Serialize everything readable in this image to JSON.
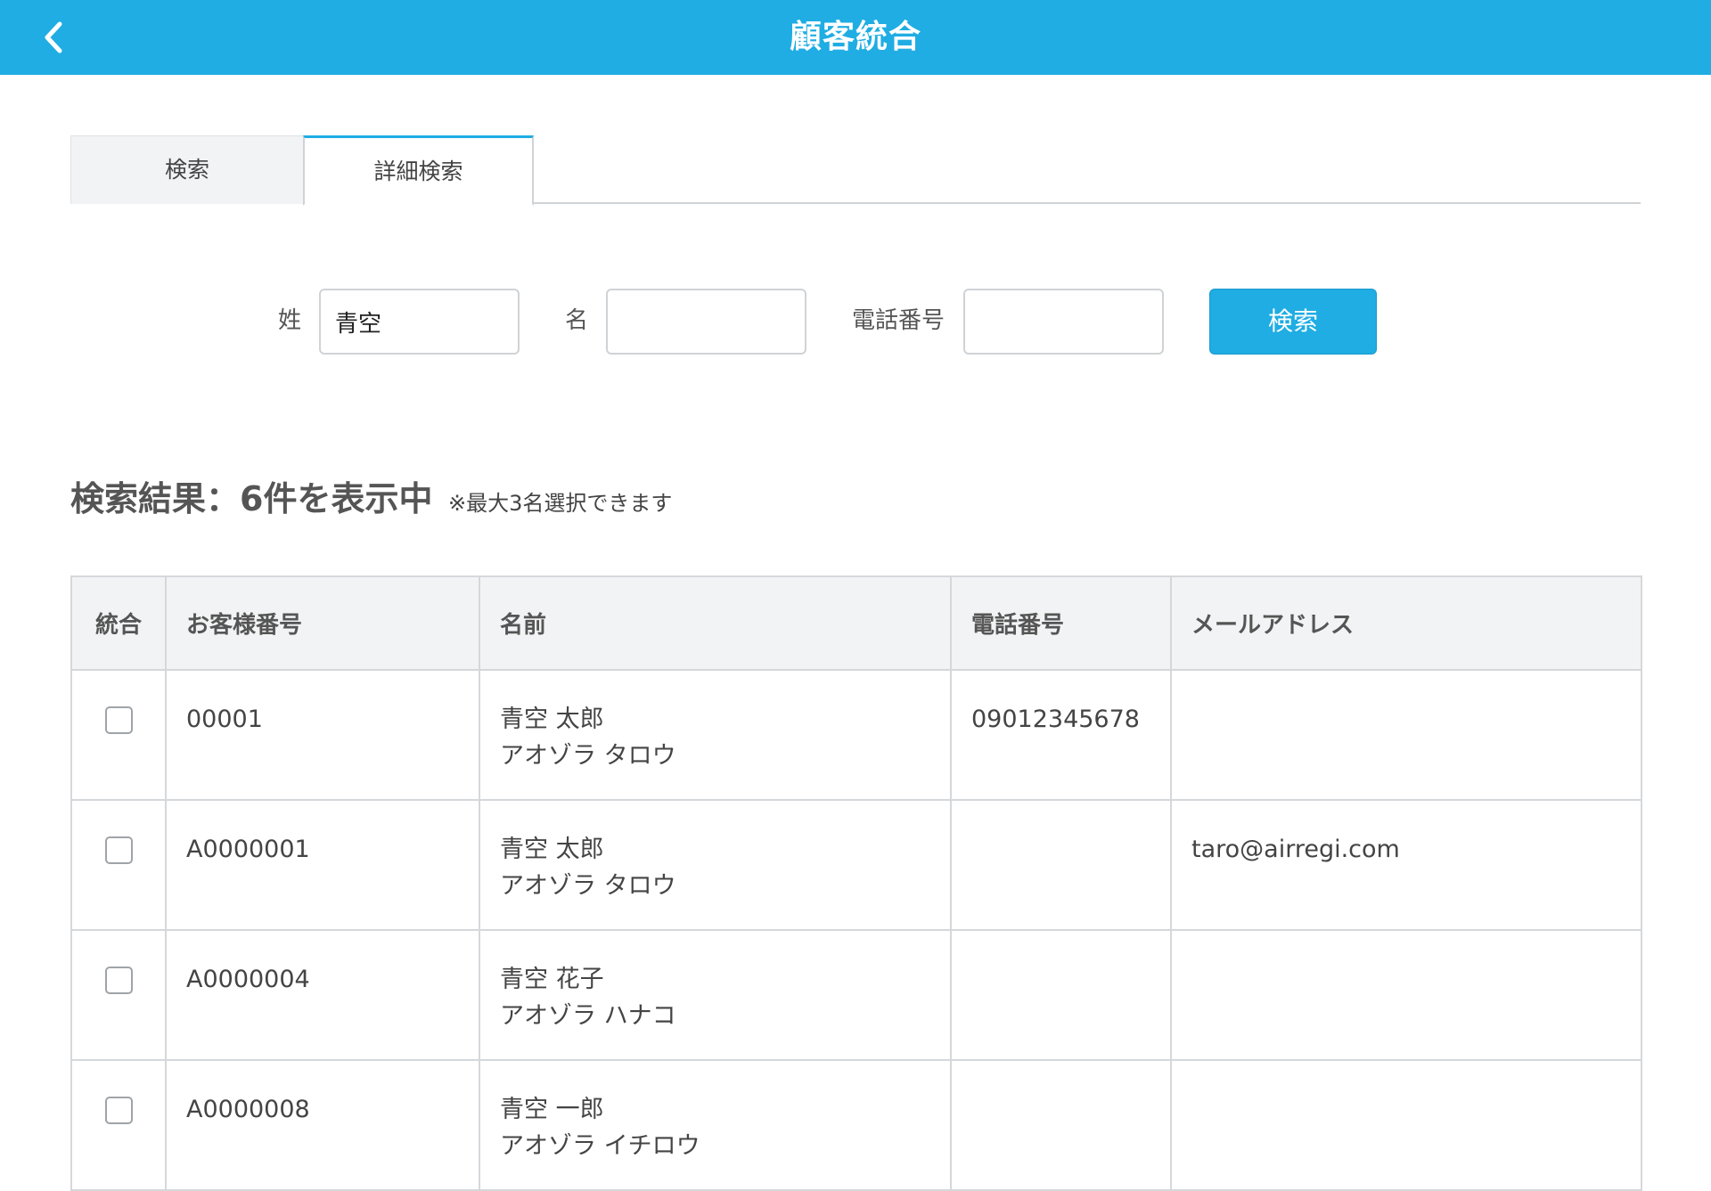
{
  "header": {
    "title": "顧客統合"
  },
  "tabs": [
    {
      "label": "検索",
      "active": false
    },
    {
      "label": "詳細検索",
      "active": true
    }
  ],
  "search_form": {
    "last_name_label": "姓",
    "last_name_value": "青空",
    "first_name_label": "名",
    "first_name_value": "",
    "phone_label": "電話番号",
    "phone_value": "",
    "submit_label": "検索"
  },
  "results": {
    "heading": "検索結果：6件を表示中",
    "note": "※最大3名選択できます",
    "columns": [
      "統合",
      "お客様番号",
      "名前",
      "電話番号",
      "メールアドレス"
    ],
    "rows": [
      {
        "customer_no": "00001",
        "name": "青空 太郎",
        "kana": "アオゾラ タロウ",
        "phone": "09012345678",
        "email": ""
      },
      {
        "customer_no": "A0000001",
        "name": "青空 太郎",
        "kana": "アオゾラ タロウ",
        "phone": "",
        "email": "taro@airregi.com"
      },
      {
        "customer_no": "A0000004",
        "name": "青空 花子",
        "kana": "アオゾラ ハナコ",
        "phone": "",
        "email": ""
      },
      {
        "customer_no": "A0000008",
        "name": "青空 一郎",
        "kana": "アオゾラ イチロウ",
        "phone": "",
        "email": ""
      }
    ]
  },
  "colors": {
    "accent": "#1fade3",
    "header_text": "#ffffff",
    "table_header_bg": "#f2f3f4",
    "border": "#d5d8db"
  }
}
